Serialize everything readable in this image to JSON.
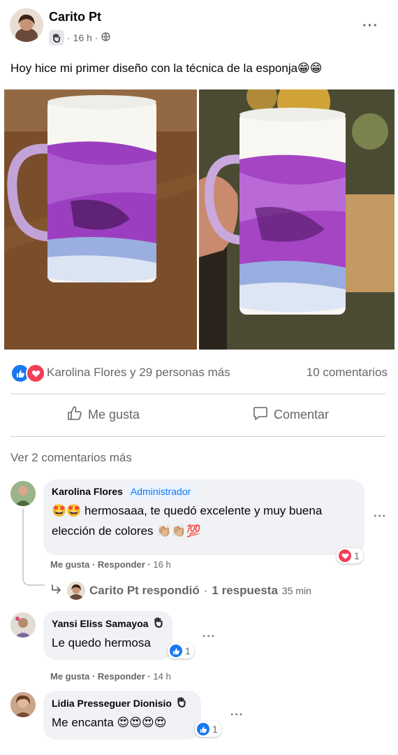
{
  "post": {
    "author": "Carito Pt",
    "time": "16 h",
    "separator": "·",
    "text": "Hoy hice mi primer diseño con la técnica de la esponja😁😁",
    "more": "···"
  },
  "reactions": {
    "names": "Karolina Flores y 29 personas más",
    "comments": "10 comentarios"
  },
  "actions": {
    "like": "Me gusta",
    "comment": "Comentar"
  },
  "view_more": "Ver 2 comentarios más",
  "comments": [
    {
      "name": "Karolina Flores",
      "badge": "Administrador",
      "text_line1": "🤩🤩 hermosaaa, te quedó excelente y muy buena",
      "text_line2": "elección de colores 👏🏼👏🏼💯",
      "like": "Me gusta",
      "reply": "Responder",
      "time": "16 h",
      "react_count": "1",
      "reply_summary_name": "Carito Pt respondió",
      "reply_summary_count": "1 respuesta",
      "reply_summary_time": "35 min"
    },
    {
      "name": "Yansi Eliss Samayoa",
      "text": "Le quedo hermosa",
      "like": "Me gusta",
      "reply": "Responder",
      "time": "14 h",
      "react_count": "1"
    },
    {
      "name": "Lidia Presseguer Dionisio",
      "text": "Me encanta 😍😍😍😍",
      "react_count": "1"
    }
  ],
  "colors": {
    "accent": "#1877f2",
    "love": "#f33e58",
    "muted": "#65676b",
    "bubble": "#f0f2f5"
  }
}
